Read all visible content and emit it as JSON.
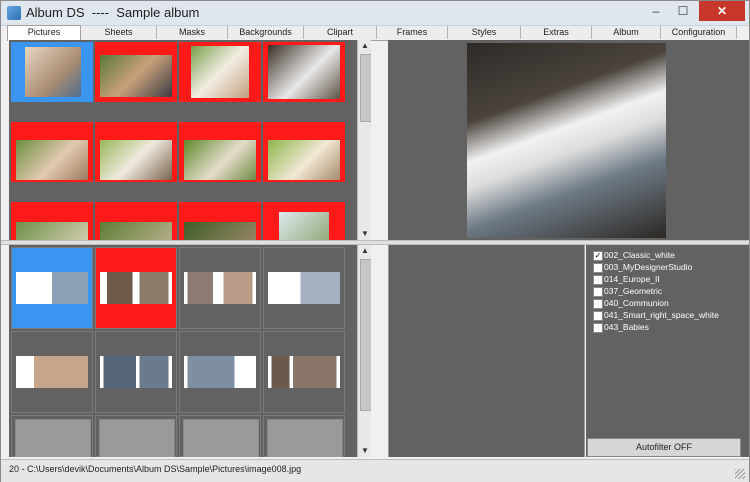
{
  "window": {
    "title": "Album DS  ----  Sample album",
    "min_glyph": "–",
    "max_glyph": "☐",
    "close_glyph": "✕"
  },
  "tabs": [
    {
      "label": "Pictures",
      "active": true
    },
    {
      "label": "Sheets"
    },
    {
      "label": "Masks"
    },
    {
      "label": "Backgrounds"
    },
    {
      "label": "Clipart"
    },
    {
      "label": "Frames"
    },
    {
      "label": "Styles"
    },
    {
      "label": "Extras"
    },
    {
      "label": "Album"
    },
    {
      "label": "Configuration"
    }
  ],
  "scroll": {
    "up": "▲",
    "down": "▼"
  },
  "styles_list": [
    {
      "label": "002_Classic_white",
      "checked": true
    },
    {
      "label": "003_MyDesignerStudio",
      "checked": false
    },
    {
      "label": "014_Europe_II",
      "checked": false
    },
    {
      "label": "037_Geometric",
      "checked": false
    },
    {
      "label": "040_Communion",
      "checked": false
    },
    {
      "label": "041_Smart_right_space_white",
      "checked": false
    },
    {
      "label": "043_Babies",
      "checked": false
    }
  ],
  "autofilter_label": "Autofilter OFF",
  "status_text": "20 - C:\\Users\\devik\\Documents\\Album DS\\Sample\\Pictures\\image008.jpg",
  "colors": {
    "selected": "#ff1a1a",
    "current": "#3a95f0",
    "pane": "#626262"
  }
}
